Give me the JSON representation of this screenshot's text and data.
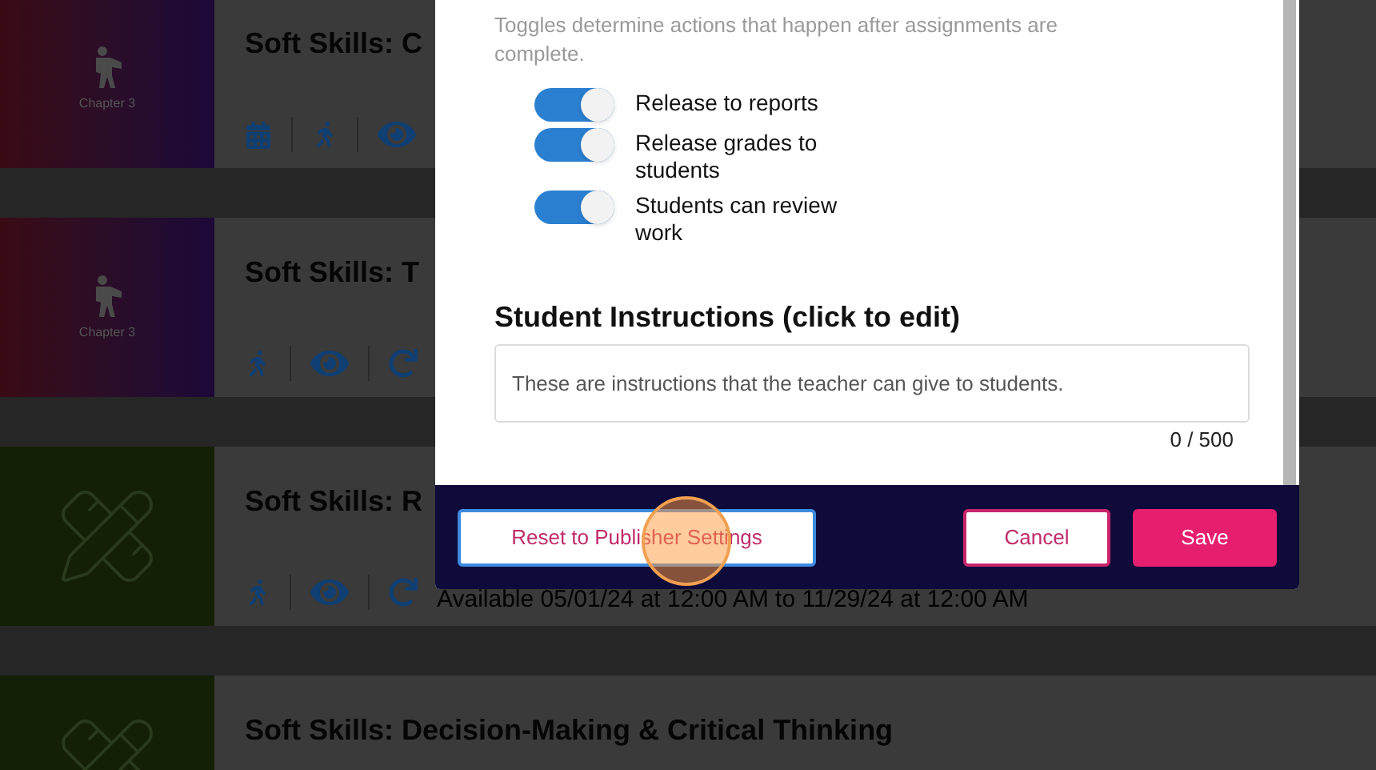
{
  "cards": [
    {
      "title": "Soft Skills: C",
      "thumbnail": {
        "kind": "chapter",
        "label": "Chapter 3"
      },
      "icons": [
        {
          "kind": "calendar"
        },
        {
          "kind": "walk"
        },
        {
          "kind": "eye"
        }
      ]
    },
    {
      "title": "Soft Skills: T",
      "thumbnail": {
        "kind": "chapter",
        "label": "Chapter 3"
      },
      "icons": [
        {
          "kind": "walk"
        },
        {
          "kind": "eye"
        },
        {
          "kind": "redo"
        }
      ]
    },
    {
      "title": "Soft Skills: R",
      "thumbnail": {
        "kind": "pencil"
      },
      "icons": [
        {
          "kind": "walk"
        },
        {
          "kind": "eye"
        },
        {
          "kind": "redo"
        }
      ],
      "availability": "Available 05/01/24 at 12:00 AM to 11/29/24 at 12:00 AM"
    },
    {
      "title": "Soft Skills: Decision-Making & Critical Thinking",
      "thumbnail": {
        "kind": "pencil"
      }
    }
  ],
  "modal": {
    "description": "Toggles determine actions that happen after assignments are complete.",
    "toggles": [
      {
        "label": "Release to reports",
        "on": true
      },
      {
        "label": "Release grades to students",
        "on": true
      },
      {
        "label": "Students can review work",
        "on": true
      }
    ],
    "instructions_heading": "Student Instructions (click to edit)",
    "instructions_field": {
      "placeholder": "These are instructions that the teacher can give to students."
    },
    "counter": "0 / 500",
    "buttons": {
      "reset": "Reset to Publisher Settings",
      "cancel": "Cancel",
      "save": "Save"
    }
  }
}
